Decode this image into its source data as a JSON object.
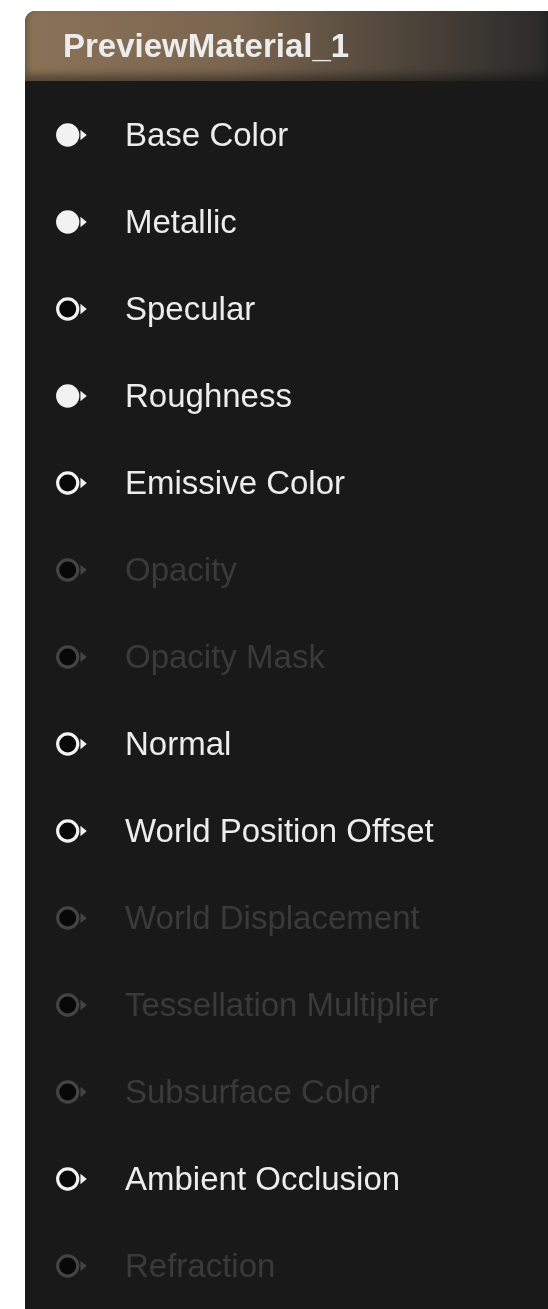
{
  "node": {
    "title": "PreviewMaterial_1"
  },
  "pins": [
    {
      "label": "Base Color",
      "connected": true,
      "disabled": false
    },
    {
      "label": "Metallic",
      "connected": true,
      "disabled": false
    },
    {
      "label": "Specular",
      "connected": false,
      "disabled": false
    },
    {
      "label": "Roughness",
      "connected": true,
      "disabled": false
    },
    {
      "label": "Emissive Color",
      "connected": false,
      "disabled": false
    },
    {
      "label": "Opacity",
      "connected": false,
      "disabled": true
    },
    {
      "label": "Opacity Mask",
      "connected": false,
      "disabled": true
    },
    {
      "label": "Normal",
      "connected": false,
      "disabled": false
    },
    {
      "label": "World Position Offset",
      "connected": false,
      "disabled": false
    },
    {
      "label": "World Displacement",
      "connected": false,
      "disabled": true
    },
    {
      "label": "Tessellation Multiplier",
      "connected": false,
      "disabled": true
    },
    {
      "label": "Subsurface Color",
      "connected": false,
      "disabled": true
    },
    {
      "label": "Ambient Occlusion",
      "connected": false,
      "disabled": false
    },
    {
      "label": "Refraction",
      "connected": false,
      "disabled": true
    }
  ]
}
